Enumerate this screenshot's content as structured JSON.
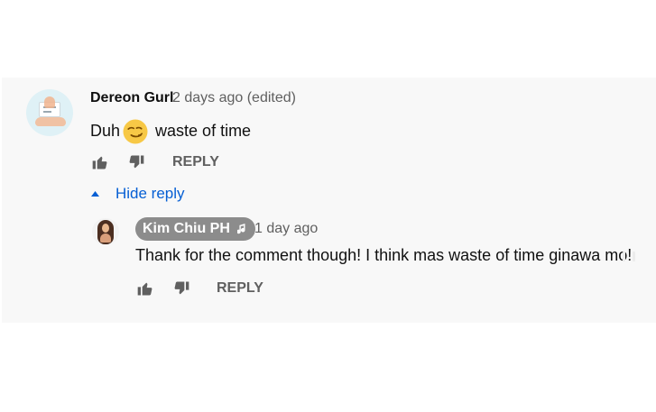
{
  "comment": {
    "author": "Dereon Gurl",
    "time_meta": "2 days ago (edited)",
    "text_before_emoji": "Duh",
    "text_after_emoji": "waste of time",
    "emoji_icon": "smirking-face-icon",
    "reply_label": "REPLY",
    "hide_reply_label": "Hide reply"
  },
  "reply": {
    "author": "Kim Chiu PH",
    "author_badge_icon": "music-note-icon",
    "time": "1 day ago",
    "text": "Thank for the comment though! I think mas waste of time ginawa mo!",
    "reply_label": "REPLY"
  },
  "icons": {
    "like": "thumbs-up-icon",
    "dislike": "thumbs-down-icon",
    "caret": "caret-up-icon"
  },
  "colors": {
    "panel_background": "#f8f8f8",
    "primary_text": "#111111",
    "secondary_text": "#606060",
    "link_blue": "#065fd4",
    "badge_gray": "#8c8c8c",
    "emoji_yellow": "#f7c846"
  }
}
